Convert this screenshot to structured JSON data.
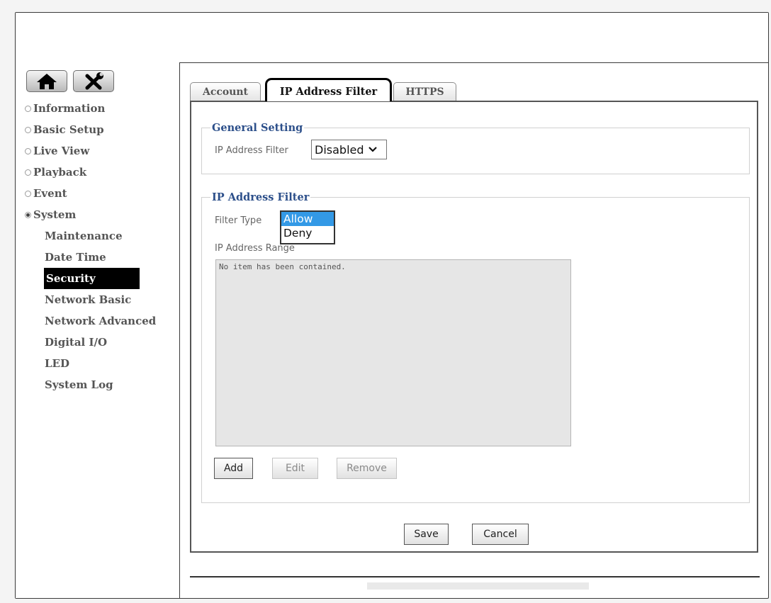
{
  "sidebar": {
    "icons": [
      {
        "name": "home-icon",
        "glyph": "home"
      },
      {
        "name": "tools-icon",
        "glyph": "tools"
      }
    ],
    "items": [
      {
        "label": "Information",
        "selected": false
      },
      {
        "label": "Basic Setup",
        "selected": false
      },
      {
        "label": "Live View",
        "selected": false
      },
      {
        "label": "Playback",
        "selected": false
      },
      {
        "label": "Event",
        "selected": false
      },
      {
        "label": "System",
        "selected": true
      }
    ],
    "system_subitems": [
      {
        "label": "Maintenance"
      },
      {
        "label": "Date Time"
      },
      {
        "label": "Security",
        "active": true
      },
      {
        "label": "Network Basic"
      },
      {
        "label": "Network Advanced"
      },
      {
        "label": "Digital I/O"
      },
      {
        "label": "LED"
      },
      {
        "label": "System Log"
      }
    ]
  },
  "tabs": [
    {
      "label": "Account",
      "active": false
    },
    {
      "label": "IP Address Filter",
      "active": true
    },
    {
      "label": "HTTPS",
      "active": false
    }
  ],
  "general_setting": {
    "legend": "General Setting",
    "filter_label": "IP Address Filter",
    "filter_value": "Disabled"
  },
  "ip_filter": {
    "legend": "IP Address Filter",
    "filter_type_label": "Filter Type",
    "filter_type_options": [
      "Allow",
      "Deny"
    ],
    "filter_type_highlighted": "Allow",
    "range_label": "IP Address Range",
    "list_empty_text": "No item has been contained.",
    "add_label": "Add",
    "edit_label": "Edit",
    "remove_label": "Remove"
  },
  "actions": {
    "save_label": "Save",
    "cancel_label": "Cancel"
  },
  "colors": {
    "legend": "#2c4f8a",
    "highlight": "#3399e6",
    "active_nav": "#000000"
  }
}
